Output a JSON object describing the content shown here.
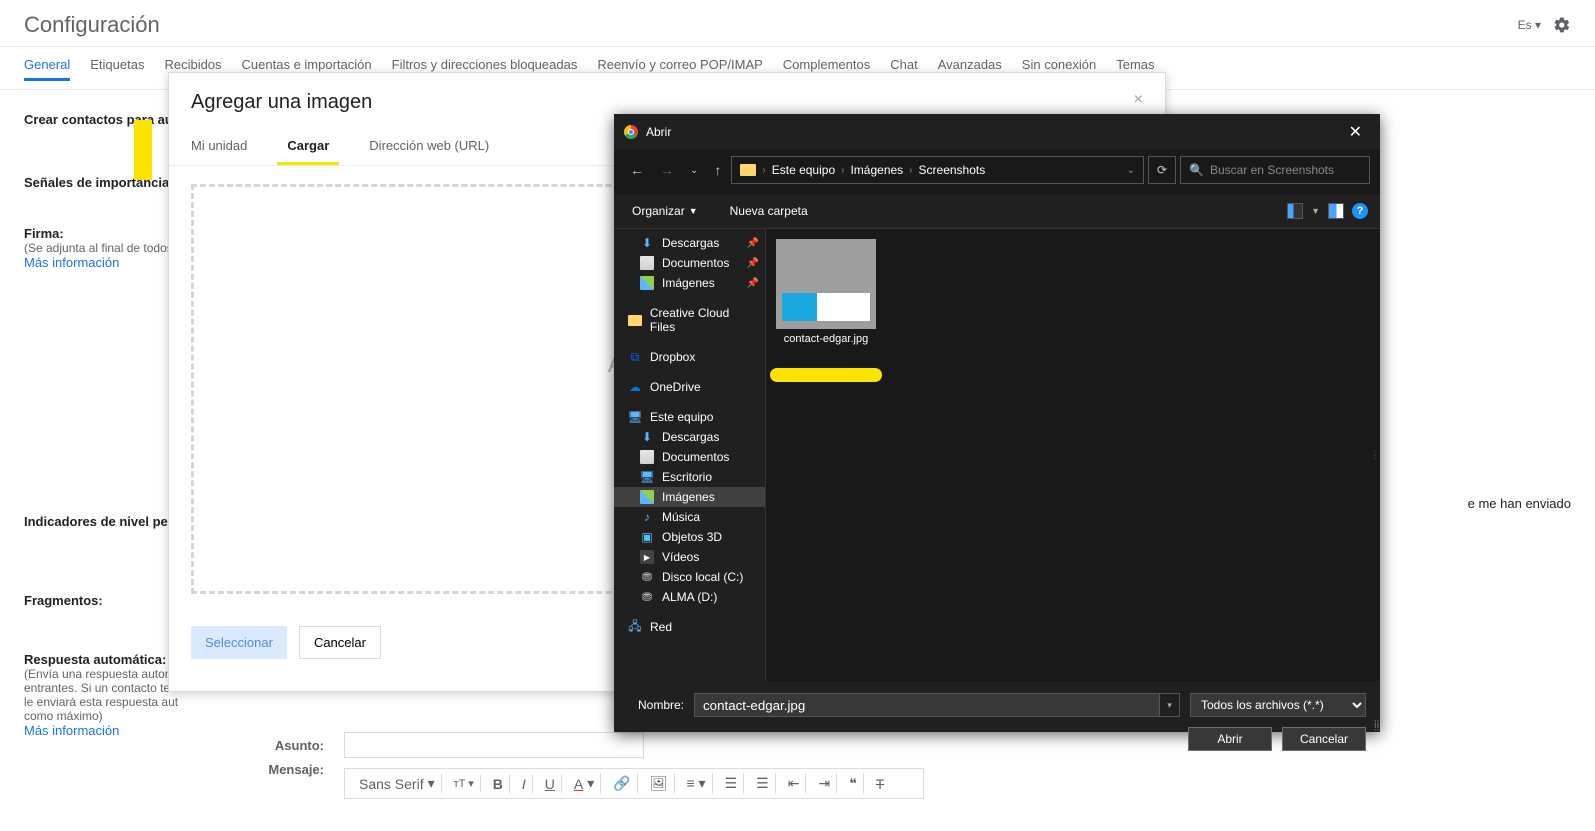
{
  "gmail": {
    "title": "Configuración",
    "language_label": "Es",
    "tabs": [
      "General",
      "Etiquetas",
      "Recibidos",
      "Cuentas e importación",
      "Filtros y direcciones bloqueadas",
      "Reenvío y correo POP/IMAP",
      "Complementos",
      "Chat",
      "Avanzadas",
      "Sin conexión",
      "Temas"
    ],
    "active_tab": 0,
    "rows": {
      "contacts": "Crear contactos para au",
      "importance": "Señales de importancia",
      "signature": {
        "label": "Firma:",
        "sub": "(Se adjunta al final de todos",
        "link": "Más información"
      },
      "indicators": "Indicadores de nivel per",
      "indicators_text_right": "e me han enviado",
      "snippets": "Fragmentos:",
      "auto": {
        "label": "Respuesta automática:",
        "sub1": "(Envía una respuesta autom",
        "sub2": "entrantes. Si un contacto te",
        "sub3": "le enviará esta respuesta aut",
        "sub4": "como máximo)",
        "link": "Más información"
      },
      "asunto": "Asunto:",
      "mensaje": "Mensaje:",
      "font": "Sans Serif"
    }
  },
  "imageModal": {
    "title": "Agregar una imagen",
    "tabs": {
      "drive": "Mi unidad",
      "upload": "Cargar",
      "url": "Dirección web (URL)"
    },
    "drop": "Arrastra un",
    "select_btn": "Seleccion",
    "footer_select": "Seleccionar",
    "footer_cancel": "Cancelar"
  },
  "win": {
    "title": "Abrir",
    "path": [
      "Este equipo",
      "Imágenes",
      "Screenshots"
    ],
    "search_placeholder": "Buscar en Screenshots",
    "organize": "Organizar",
    "new_folder": "Nueva carpeta",
    "sidebar": [
      {
        "icon": "down",
        "label": "Descargas",
        "pin": true,
        "indent": true
      },
      {
        "icon": "doc",
        "label": "Documentos",
        "pin": true,
        "indent": true
      },
      {
        "icon": "img",
        "label": "Imágenes",
        "pin": true,
        "indent": true
      },
      {
        "sep": true
      },
      {
        "icon": "folder",
        "label": "Creative Cloud Files",
        "top": true
      },
      {
        "sep": true
      },
      {
        "icon": "dropbox",
        "label": "Dropbox",
        "top": true
      },
      {
        "sep": true
      },
      {
        "icon": "onedrive",
        "label": "OneDrive",
        "top": true
      },
      {
        "sep": true
      },
      {
        "icon": "pc",
        "label": "Este equipo",
        "top": true
      },
      {
        "icon": "down",
        "label": "Descargas",
        "indent": true
      },
      {
        "icon": "doc",
        "label": "Documentos",
        "indent": true
      },
      {
        "icon": "desktop",
        "label": "Escritorio",
        "indent": true
      },
      {
        "icon": "img",
        "label": "Imágenes",
        "indent": true,
        "selected": true
      },
      {
        "icon": "music",
        "label": "Música",
        "indent": true
      },
      {
        "icon": "3d",
        "label": "Objetos 3D",
        "indent": true
      },
      {
        "icon": "video",
        "label": "Vídeos",
        "indent": true
      },
      {
        "icon": "disk",
        "label": "Disco local (C:)",
        "indent": true
      },
      {
        "icon": "disk",
        "label": "ALMA (D:)",
        "indent": true
      },
      {
        "sep": true
      },
      {
        "icon": "net",
        "label": "Red",
        "top": true
      }
    ],
    "file": {
      "name": "contact-edgar.jpg"
    },
    "name_label": "Nombre:",
    "name_value": "contact-edgar.jpg",
    "filter": "Todos los archivos (*.*)",
    "open": "Abrir",
    "cancel": "Cancelar"
  }
}
